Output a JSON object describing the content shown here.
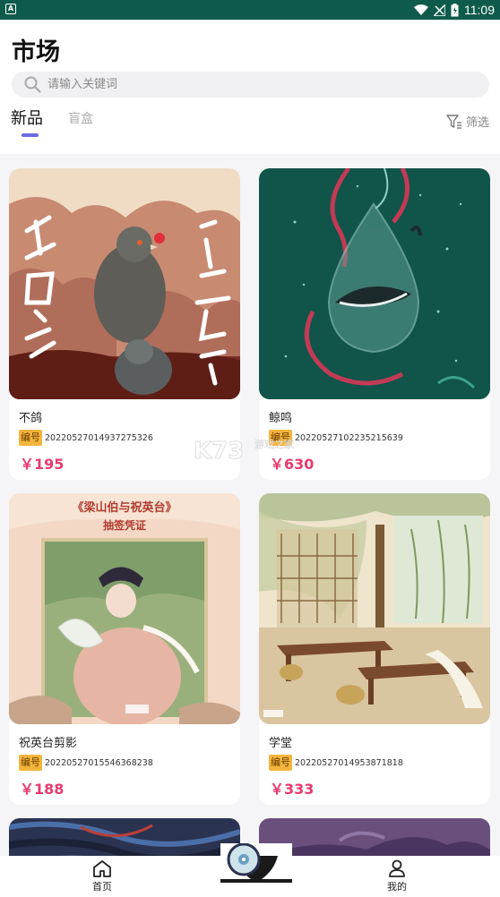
{
  "status_bar": {
    "time": "11:09",
    "app_indicator": "A"
  },
  "page": {
    "title": "市场"
  },
  "search": {
    "placeholder": "请输入关键词",
    "value": ""
  },
  "tabs": [
    {
      "label": "新品",
      "active": true
    },
    {
      "label": "盲盒",
      "active": false
    }
  ],
  "filter": {
    "label": "筛选",
    "icon": "filter-icon"
  },
  "cards": [
    {
      "name": "不鸽",
      "badge": "编号",
      "id": "20220527014937275326",
      "price": "￥195"
    },
    {
      "name": "鲸鸣",
      "badge": "编号",
      "id": "20220527102235215639",
      "price": "￥630"
    },
    {
      "name": "祝英台剪影",
      "badge": "编号",
      "id": "20220527015546368238",
      "price": "￥188"
    },
    {
      "name": "学堂",
      "badge": "编号",
      "id": "20220527014953871818",
      "price": "￥333"
    }
  ],
  "image_texts": {
    "card3_banner_1": "《梁山伯与祝英台》",
    "card3_banner_2": "抽签凭证"
  },
  "bottom_nav": [
    {
      "label": "首页",
      "icon": "home-icon"
    },
    {
      "label": "我的",
      "icon": "user-icon"
    }
  ],
  "watermark": {
    "brand": "K73",
    "sub": "游戏之家"
  },
  "colors": {
    "accent_price": "#e83a6f",
    "tab_indicator": "#6b6be3",
    "badge": "#f3b53c",
    "status_bar": "#0f5b4b"
  }
}
